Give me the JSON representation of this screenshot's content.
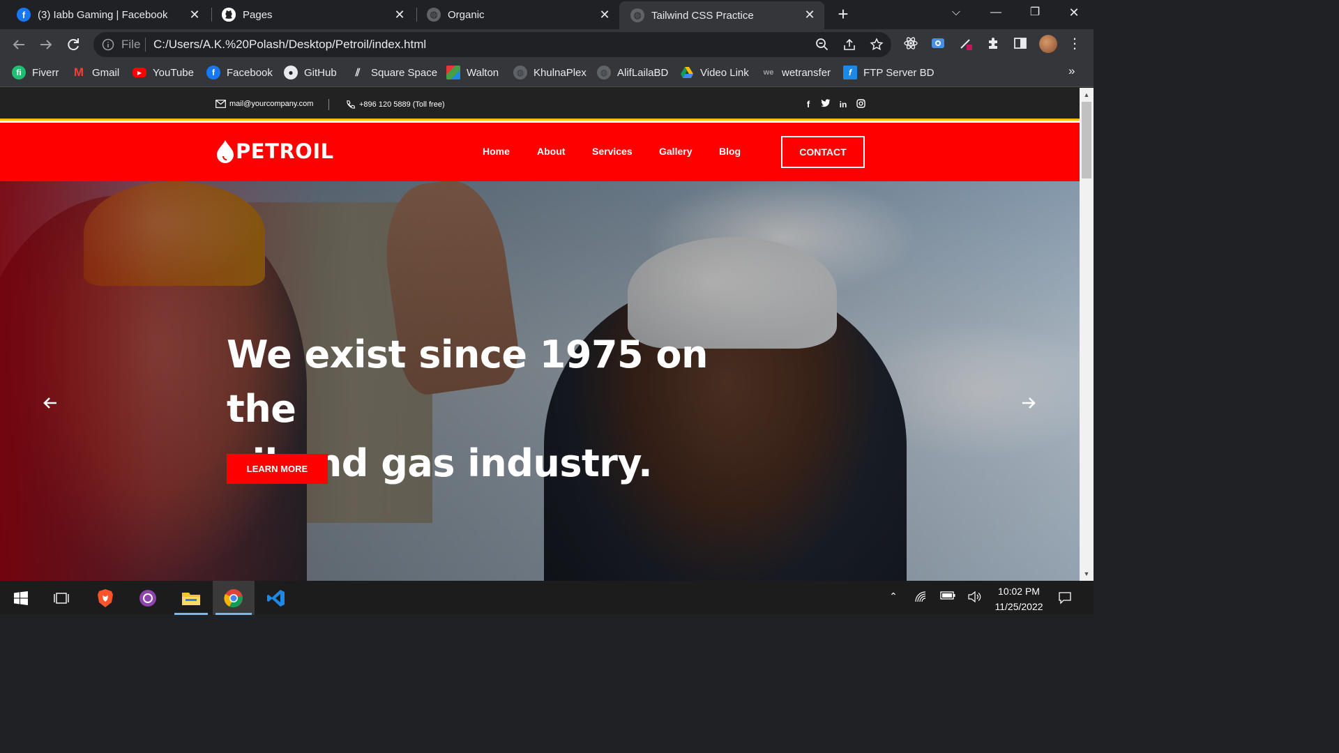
{
  "browser": {
    "tabs": [
      {
        "title": "(3) Iabb Gaming | Facebook",
        "icon": "facebook-icon",
        "active": false
      },
      {
        "title": "Pages",
        "icon": "github-icon",
        "active": false
      },
      {
        "title": "Organic",
        "icon": "globe-icon",
        "active": false
      },
      {
        "title": "Tailwind CSS Practice",
        "icon": "globe-icon",
        "active": true
      }
    ],
    "address": {
      "scheme_label": "File",
      "url": "C:/Users/A.K.%20Polash/Desktop/Petroil/index.html"
    },
    "bookmarks": [
      {
        "label": "Fiverr",
        "icon": "fiverr-icon"
      },
      {
        "label": "Gmail",
        "icon": "gmail-icon"
      },
      {
        "label": "YouTube",
        "icon": "youtube-icon"
      },
      {
        "label": "Facebook",
        "icon": "facebook-icon"
      },
      {
        "label": "GitHub",
        "icon": "github-icon"
      },
      {
        "label": "Square Space",
        "icon": "squarespace-icon"
      },
      {
        "label": "Walton",
        "icon": "walton-icon"
      },
      {
        "label": "KhulnaPlex",
        "icon": "globe-icon"
      },
      {
        "label": "AlifLailaBD",
        "icon": "globe-icon"
      },
      {
        "label": "Video Link",
        "icon": "google-drive-icon"
      },
      {
        "label": "wetransfer",
        "icon": "wetransfer-icon"
      },
      {
        "label": "FTP Server BD",
        "icon": "ftp-icon"
      }
    ],
    "bookmarks_more": "»"
  },
  "page": {
    "topbar": {
      "email": "mail@yourcompany.com",
      "phone": "+896 120 5889 (Toll free)",
      "socials": [
        "f",
        "t",
        "in",
        "ig"
      ]
    },
    "nav": {
      "logo": "PETROIL",
      "links": [
        "Home",
        "About",
        "Services",
        "Gallery",
        "Blog"
      ],
      "contact": "CONTACT"
    },
    "hero": {
      "title_line1": "We exist since 1975 on the",
      "title_line2": "oil and gas industry.",
      "button": "LEARN MORE"
    },
    "colors": {
      "brand_red": "#ff0000",
      "topbar_dark": "#222222",
      "accent_yellow": "#ffc107"
    }
  },
  "taskbar": {
    "time": "10:02 PM",
    "date": "11/25/2022"
  }
}
